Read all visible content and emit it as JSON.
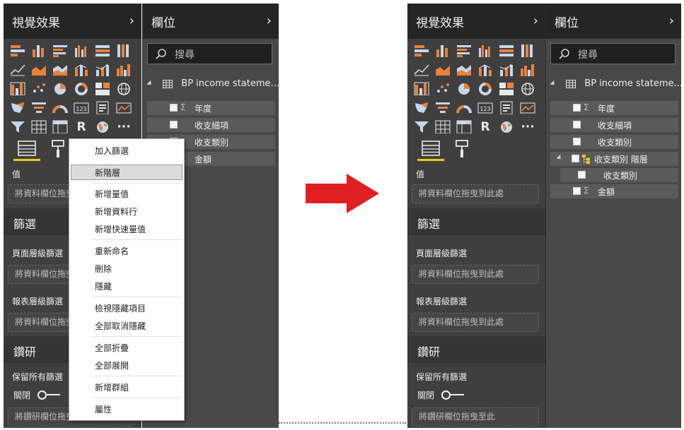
{
  "left": {
    "vis_title": "視覺效果",
    "fields_title": "欄位",
    "value_label": "值",
    "value_drop": "將資料欄位拖曳到此處",
    "filters_title": "篩選",
    "page_filter_label": "頁面層級篩選",
    "page_filter_drop": "將資料欄位拖曳到此處",
    "report_filter_label": "報表層級篩選",
    "report_filter_drop": "將資料欄位拖曳到此處",
    "drill_title": "鑽研",
    "keep_filters_label": "保留所有篩選",
    "toggle_label": "關閉",
    "drill_drop": "將鑽研欄位拖曳至此",
    "search_placeholder": "搜尋",
    "table_name": "BP income stateme...",
    "fields": [
      "年度",
      "收支細項",
      "收支類別",
      "金額"
    ]
  },
  "context_menu": {
    "items": [
      "加入篩選",
      "新階層",
      "新增量值",
      "新增資料行",
      "新增快速量值",
      "重新命名",
      "刪除",
      "隱藏",
      "檢視隱藏項目",
      "全部取消隱藏",
      "全部折疊",
      "全部展開",
      "新增群組",
      "屬性"
    ],
    "highlighted": "新階層"
  },
  "right": {
    "vis_title": "視覺效果",
    "fields_title": "欄位",
    "value_label": "值",
    "value_drop": "將資料欄位拖曳到此處",
    "filters_title": "篩選",
    "page_filter_label": "頁面層級篩選",
    "page_filter_drop": "將資料欄位拖曳到此處",
    "report_filter_label": "報表層級篩選",
    "report_filter_drop": "將資料欄位拖曳到此處",
    "drill_title": "鑽研",
    "keep_filters_label": "保留所有篩選",
    "toggle_label": "關閉",
    "drill_drop": "將鑽研欄位拖曳至此",
    "search_placeholder": "搜尋",
    "table_name": "BP income stateme...",
    "fields": [
      "年度",
      "收支細項",
      "收支類別",
      "收支類別 階層",
      "收支類別",
      "金額"
    ]
  },
  "icons": {
    "chevron": "›",
    "r_visual": "R",
    "more": "···",
    "row4_number": "123"
  },
  "colors": {
    "accent_yellow": "#f2c811",
    "arrow_red": "#e02020",
    "viz_orange": "#e8823c",
    "viz_blue": "#c7d7ea"
  }
}
